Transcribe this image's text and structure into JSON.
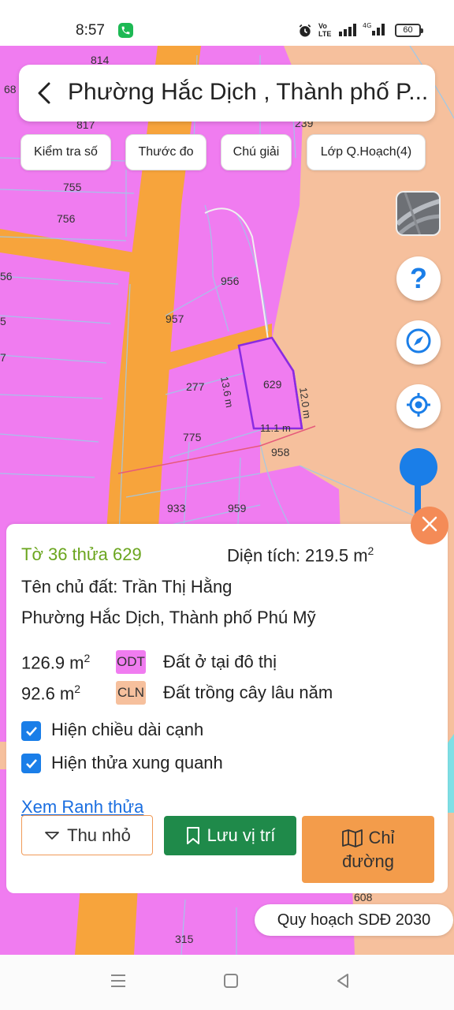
{
  "status_bar": {
    "time": "8:57",
    "volte": "Vo\nLTE",
    "net": "4G",
    "battery": "60"
  },
  "map": {
    "plot_labels": [
      "814",
      "68",
      "817",
      "239",
      "755",
      "756",
      "56",
      "5",
      "956",
      "957",
      "277",
      "629",
      "775",
      "958",
      "933",
      "959",
      "608",
      "315",
      "7"
    ],
    "edge_labels": {
      "left": "13.6 m",
      "right": "12.0 m",
      "bottom": "11.1 m"
    },
    "colors": {
      "odt": "#f07cf0",
      "cln": "#f6c09d",
      "road": "#f7a43c",
      "selected": "#8a2be2"
    }
  },
  "header": {
    "title": "Phường Hắc Dịch , Thành phố P..."
  },
  "toolbar": {
    "check": "Kiểm tra số",
    "ruler": "Thước đo",
    "legend": "Chú giải",
    "layers": "Lớp Q.Hoạch(4)"
  },
  "panel": {
    "sheet_parcel": "Tờ 36 thửa 629",
    "area_label": "Diện tích: 219.5 m",
    "area_sup": "2",
    "owner": "Tên chủ đất: Trần Thị Hằng",
    "address": "Phường Hắc Dịch, Thành phố Phú Mỹ",
    "landuse": [
      {
        "area": "126.9 m",
        "sup": "2",
        "code": "ODT",
        "name": "Đất ở tại đô thị",
        "color": "#f07cf0"
      },
      {
        "area": "92.6 m",
        "sup": "2",
        "code": "CLN",
        "name": "Đất trồng cây lâu năm",
        "color": "#f6c09d"
      }
    ],
    "check_edges": "Hiện chiều dài cạnh",
    "check_neighbors": "Hiện thửa xung quanh",
    "view_boundary": "Xem Ranh thửa",
    "btn_shrink": "Thu nhỏ",
    "btn_save": "Lưu vị trí",
    "btn_route_1": "Chỉ",
    "btn_route_2": "đường"
  },
  "plan_label": "Quy hoạch SDĐ 2030"
}
